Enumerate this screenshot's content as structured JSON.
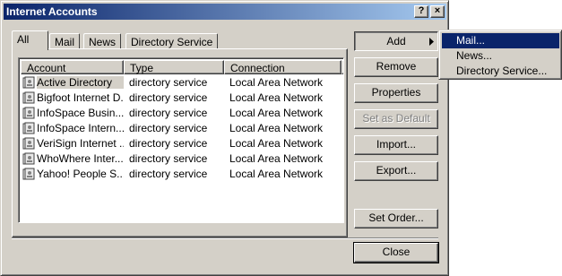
{
  "window": {
    "title": "Internet Accounts",
    "help_label": "?",
    "close_label": "×"
  },
  "tabs": [
    {
      "label": "All",
      "active": true
    },
    {
      "label": "Mail",
      "active": false
    },
    {
      "label": "News",
      "active": false
    },
    {
      "label": "Directory Service",
      "active": false
    }
  ],
  "list": {
    "columns": [
      "Account",
      "Type",
      "Connection"
    ],
    "rows": [
      {
        "account": "Active Directory",
        "type": "directory service",
        "connection": "Local Area Network",
        "selected": true
      },
      {
        "account": "Bigfoot Internet D...",
        "type": "directory service",
        "connection": "Local Area Network"
      },
      {
        "account": "InfoSpace Busin...",
        "type": "directory service",
        "connection": "Local Area Network"
      },
      {
        "account": "InfoSpace Intern...",
        "type": "directory service",
        "connection": "Local Area Network"
      },
      {
        "account": "VeriSign Internet ...",
        "type": "directory service",
        "connection": "Local Area Network"
      },
      {
        "account": "WhoWhere Inter...",
        "type": "directory service",
        "connection": "Local Area Network"
      },
      {
        "account": "Yahoo! People S...",
        "type": "directory service",
        "connection": "Local Area Network"
      }
    ]
  },
  "buttons": {
    "add": "Add",
    "remove": "Remove",
    "properties": "Properties",
    "set_default": "Set as Default",
    "import": "Import...",
    "export": "Export...",
    "set_order": "Set Order...",
    "close": "Close"
  },
  "add_menu": {
    "items": [
      "Mail...",
      "News...",
      "Directory Service..."
    ],
    "highlighted": "Mail..."
  },
  "colors": {
    "titlebar_start": "#0a246a",
    "titlebar_end": "#a6caf0",
    "face": "#d4d0c8",
    "highlight": "#0a246a"
  }
}
